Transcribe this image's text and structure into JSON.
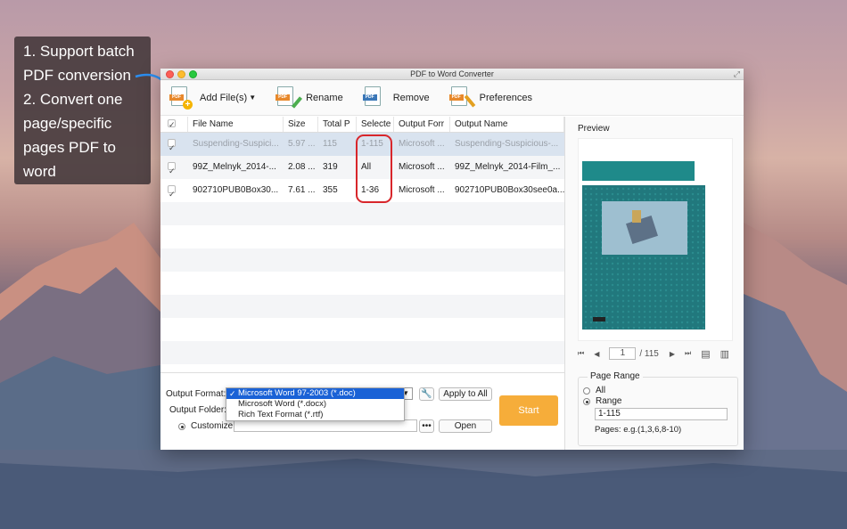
{
  "callout": {
    "text": "1. Support batch\nPDF conversion\n2. Convert one\npage/specific\npages PDF to\nword"
  },
  "window": {
    "title": "PDF to Word Converter"
  },
  "toolbar": {
    "add_files": "Add File(s)",
    "rename": "Rename",
    "remove": "Remove",
    "preferences": "Preferences",
    "icons": [
      "pdf-add-icon",
      "pdf-rename-icon",
      "pdf-remove-icon",
      "pdf-preferences-icon"
    ]
  },
  "table": {
    "headers": [
      "File Name",
      "Size",
      "Total P",
      "Selecte",
      "Output Forr",
      "Output Name"
    ],
    "rows": [
      {
        "name": "Suspending-Suspici...",
        "size": "5.97 ...",
        "total": "115",
        "selected": "1-115",
        "format": "Microsoft ...",
        "output": "Suspending-Suspicious-...",
        "checked": true,
        "highlighted": true
      },
      {
        "name": "99Z_Melnyk_2014-...",
        "size": "2.08 ...",
        "total": "319",
        "selected": "All",
        "format": "Microsoft ...",
        "output": "99Z_Melnyk_2014-Film_...",
        "checked": true,
        "highlighted": false
      },
      {
        "name": "902710PUB0Box30...",
        "size": "7.61 ...",
        "total": "355",
        "selected": "1-36",
        "format": "Microsoft ...",
        "output": "902710PUB0Box30see0a...",
        "checked": true,
        "highlighted": false
      }
    ]
  },
  "bottom": {
    "output_format_label": "Output Format:",
    "output_folder_label": "Output Folder:",
    "customize_label": "Customize:",
    "format_options": [
      "Microsoft Word 97-2003 (*.doc)",
      "Microsoft Word (*.docx)",
      "Rich Text Format (*.rtf)"
    ],
    "selected_format": "Microsoft Word 97-2003 (*.doc)",
    "apply_all": "Apply to All",
    "browse": "•••",
    "open": "Open",
    "start": "Start"
  },
  "preview": {
    "label": "Preview",
    "current_page": "1",
    "total_pages": "/ 115",
    "page_range_title": "Page Range",
    "all_label": "All",
    "range_label": "Range",
    "range_value": "1-115",
    "hint": "Pages: e.g.(1,3,6,8-10)",
    "range_selected": true
  },
  "colors": {
    "start_button": "#f6ad3a",
    "highlight_box": "#d8262b",
    "selected_row": "#d9e3ef",
    "dropdown_active": "#1a62d6"
  }
}
